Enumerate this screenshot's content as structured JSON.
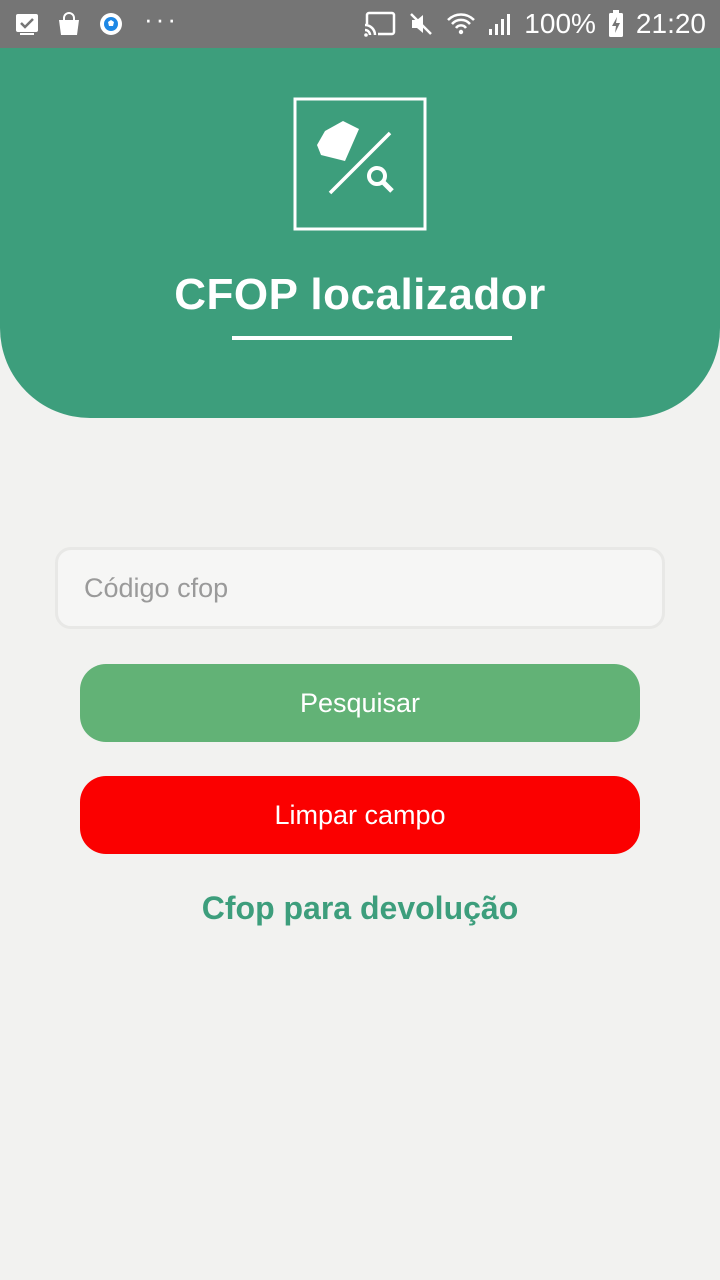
{
  "status_bar": {
    "icons_left": [
      "checkbox-notification-icon",
      "shopping-bag-icon",
      "soccer-ball-icon",
      "more-dots-icon"
    ],
    "more_dots": "···",
    "icons_right": [
      "cast-icon",
      "mute-icon",
      "wifi-icon",
      "signal-icon",
      "battery-charging-icon"
    ],
    "battery": "100%",
    "time": "21:20"
  },
  "header": {
    "title": "CFOP localizador",
    "background_color": "#3d9e7c",
    "logo_icon": "document-search-icon"
  },
  "form": {
    "input_placeholder": "Código cfop",
    "input_value": "",
    "search_button_label": "Pesquisar",
    "search_button_color": "#62b276",
    "clear_button_label": "Limpar campo",
    "clear_button_color": "#fb0000",
    "return_link_label": "Cfop para devolução"
  }
}
